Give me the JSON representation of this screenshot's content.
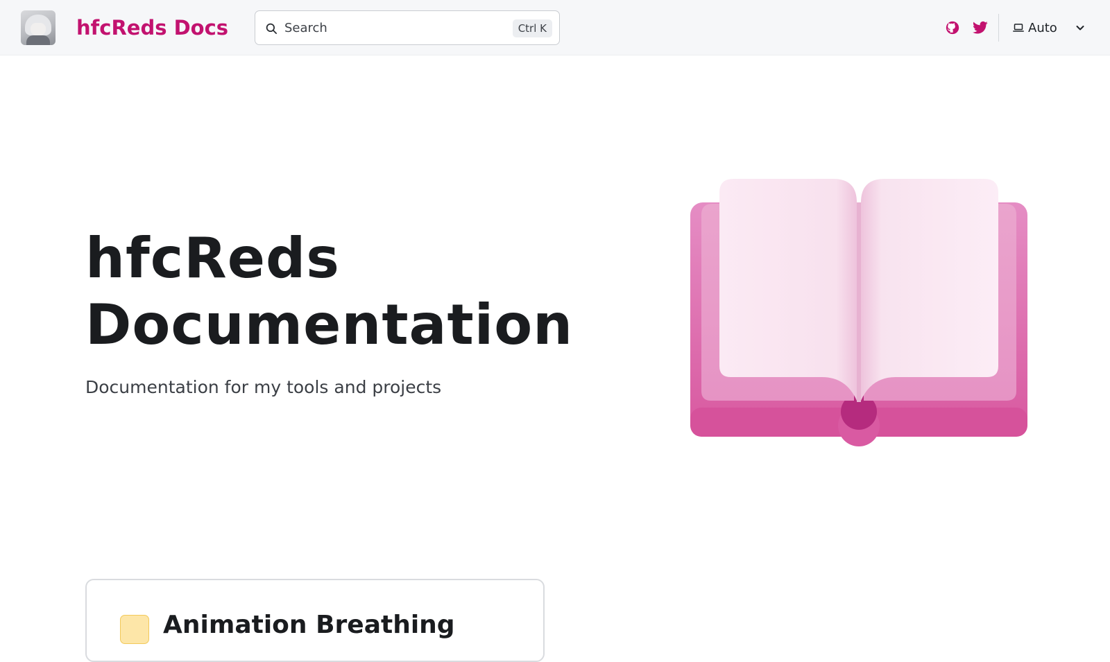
{
  "header": {
    "brand": "hfcReds Docs",
    "search": {
      "placeholder": "Search",
      "shortcut": "Ctrl K"
    },
    "theme": {
      "selected": "Auto"
    },
    "icons": {
      "github": "github-icon",
      "twitter": "twitter-icon",
      "search": "search-icon",
      "theme": "laptop-icon",
      "dropdown": "chevron-down-icon"
    }
  },
  "hero": {
    "title_line1": "hfcReds",
    "title_line2": "Documentation",
    "subtitle": "Documentation for my tools and projects",
    "illustration": "open-book-icon"
  },
  "cards": [
    {
      "title": "Animation Breathing",
      "icon": "card-emoji-icon"
    }
  ],
  "colors": {
    "accent": "#c2126f",
    "navbar_bg": "#f6f7f9",
    "book_pink": "#e06aae"
  }
}
